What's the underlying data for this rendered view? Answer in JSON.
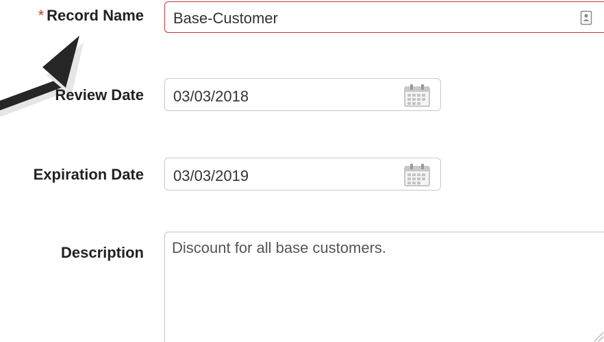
{
  "form": {
    "record_name": {
      "required_marker": "*",
      "label": "Record Name",
      "value": "Base-Customer",
      "icon": "contact-card-icon"
    },
    "review_date": {
      "label": "Review Date",
      "value": "03/03/2018",
      "icon": "calendar-icon"
    },
    "expiration_date": {
      "label": "Expiration Date",
      "value": "03/03/2019",
      "icon": "calendar-icon"
    },
    "description": {
      "label": "Description",
      "value": "Discount for all base customers."
    }
  },
  "annotation": {
    "icon": "pointer-arrow-icon",
    "color": "#262626"
  },
  "colors": {
    "required": "#c23934",
    "border": "#c8c8c8",
    "label": "#222222"
  }
}
